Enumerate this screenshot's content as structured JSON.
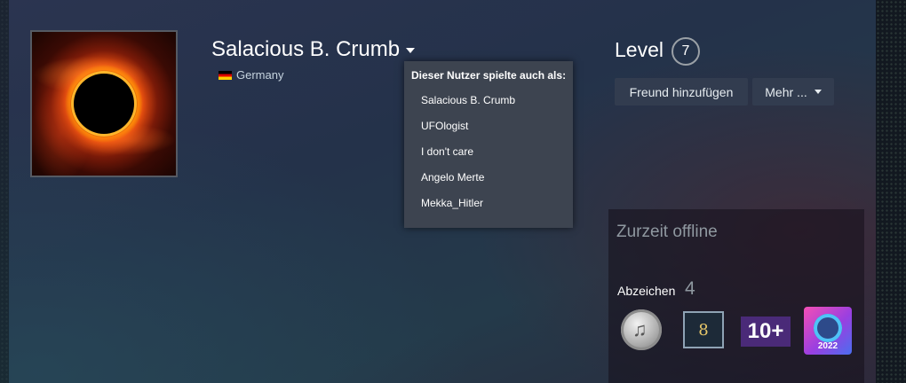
{
  "profile": {
    "persona_name": "Salacious B. Crumb",
    "country": "Germany"
  },
  "alias_dropdown": {
    "header": "Dieser Nutzer spielte auch als:",
    "items": [
      "Salacious B. Crumb",
      "UFOlogist",
      "I don't care",
      "Angelo Merte",
      "Mekka_Hitler"
    ]
  },
  "level": {
    "label": "Level",
    "value": "7"
  },
  "actions": {
    "add_friend": "Freund hinzufügen",
    "more": "Mehr ..."
  },
  "status": {
    "text": "Zurzeit offline"
  },
  "badges": {
    "label": "Abzeichen",
    "count": "4",
    "items": [
      {
        "icon": "silver-coin-badge-icon"
      },
      {
        "icon": "badge-8-icon",
        "text": "8"
      },
      {
        "icon": "years-badge-icon",
        "text": "10+"
      },
      {
        "icon": "steam-replay-2022-badge-icon",
        "text": "2022"
      }
    ]
  },
  "colors": {
    "dropdown_bg": "#3d4450",
    "button_bg": "#323c4f",
    "status_text": "#8f98a0"
  }
}
